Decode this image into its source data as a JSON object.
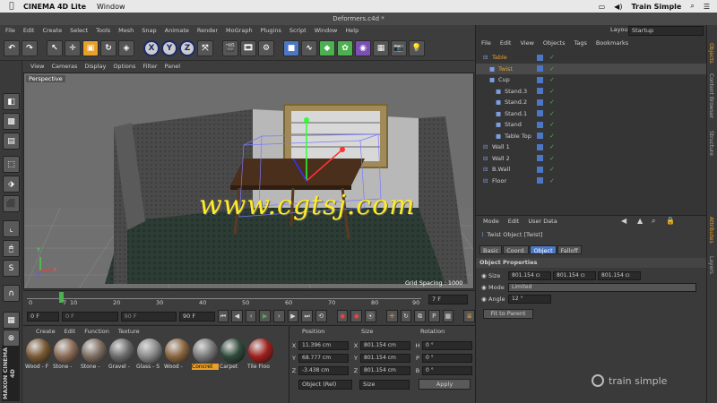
{
  "mac": {
    "app": "CINEMA 4D Lite",
    "menu": [
      "Window"
    ],
    "right_user": "Train Simple"
  },
  "window_title": "Deformers.c4d *",
  "menubar": [
    "File",
    "Edit",
    "Create",
    "Select",
    "Tools",
    "Mesh",
    "Snap",
    "Animate",
    "Render",
    "MoGraph",
    "Plugins",
    "Script",
    "Window",
    "Help"
  ],
  "toolbar": {
    "axes": [
      "X",
      "Y",
      "Z"
    ]
  },
  "viewport": {
    "menu": [
      "View",
      "Cameras",
      "Display",
      "Options",
      "Filter",
      "Panel"
    ],
    "label": "Perspective",
    "grid_spacing": "Grid Spacing : 1000 cm",
    "watermark": "www.cgtsj.com",
    "axis_x": "X",
    "axis_y": "Y",
    "axis_z": "Z"
  },
  "timeline": {
    "ticks": [
      "0",
      "10",
      "20",
      "30",
      "40",
      "50",
      "60",
      "70",
      "80",
      "90"
    ],
    "current": "7",
    "frame_readout": "7 F"
  },
  "transport": {
    "start": "0 F",
    "preview_start": "0 F",
    "preview_end": "90 F",
    "end": "90 F"
  },
  "materials": {
    "menu": [
      "Create",
      "Edit",
      "Function",
      "Texture"
    ],
    "items": [
      {
        "label": "Wood - F",
        "color": "#7a5a34"
      },
      {
        "label": "Stone - ",
        "color": "#8a6a55"
      },
      {
        "label": "Stone - ",
        "color": "#7d6d60"
      },
      {
        "label": "Gravel - ",
        "color": "#6b6b6b"
      },
      {
        "label": "Glass - S",
        "color": "#8a8a8a"
      },
      {
        "label": "Wood - ",
        "color": "#8a6540"
      },
      {
        "label": "Concret",
        "color": "#7a7a7a"
      },
      {
        "label": "Carpet",
        "color": "#2f4a3a"
      },
      {
        "label": "Tile Floo",
        "color": "#a0201e"
      }
    ]
  },
  "coords": {
    "headers": [
      "Position",
      "Size",
      "Rotation"
    ],
    "rows": [
      {
        "a": "X",
        "pos": "11.396 cm",
        "sa": "X",
        "size": "801.154 cm",
        "ra": "H",
        "rot": "0 °"
      },
      {
        "a": "Y",
        "pos": "68.777 cm",
        "sa": "Y",
        "size": "801.154 cm",
        "ra": "P",
        "rot": "0 °"
      },
      {
        "a": "Z",
        "pos": "-3.438 cm",
        "sa": "Z",
        "size": "801.154 cm",
        "ra": "B",
        "rot": "0 °"
      }
    ],
    "mode": "Object (Rel)",
    "size_mode": "Size",
    "apply": "Apply"
  },
  "layout": {
    "label": "Layout:",
    "value": "Startup"
  },
  "objects": {
    "menu": [
      "File",
      "Edit",
      "View",
      "Objects",
      "Tags",
      "Bookmarks"
    ],
    "items": [
      {
        "name": "Table",
        "indent": 0,
        "color": "#e8a02a"
      },
      {
        "name": "Twist",
        "indent": 1,
        "color": "#e8a02a"
      },
      {
        "name": "Cup",
        "indent": 1,
        "color": "#d0d0d0"
      },
      {
        "name": "Stand.3",
        "indent": 2,
        "color": "#d0d0d0"
      },
      {
        "name": "Stand.2",
        "indent": 2,
        "color": "#d0d0d0"
      },
      {
        "name": "Stand.1",
        "indent": 2,
        "color": "#d0d0d0"
      },
      {
        "name": "Stand",
        "indent": 2,
        "color": "#d0d0d0"
      },
      {
        "name": "Table Top",
        "indent": 2,
        "color": "#d0d0d0"
      },
      {
        "name": "Wall 1",
        "indent": 0,
        "color": "#d0d0d0"
      },
      {
        "name": "Wall 2",
        "indent": 0,
        "color": "#d0d0d0"
      },
      {
        "name": "B.Wall",
        "indent": 0,
        "color": "#d0d0d0"
      },
      {
        "name": "Floor",
        "indent": 0,
        "color": "#d0d0d0"
      }
    ]
  },
  "attributes": {
    "menu": [
      "Mode",
      "Edit",
      "User Data"
    ],
    "object": "Twist Object [Twist]",
    "tabs": [
      "Basic",
      "Coord.",
      "Object",
      "Falloff"
    ],
    "active_tab": "Object",
    "section": "Object Properties",
    "size_label": "Size",
    "size": [
      "801.154 cı",
      "801.154 cı",
      "801.154 cı"
    ],
    "mode_label": "Mode",
    "mode": "Limited",
    "angle_label": "Angle",
    "angle": "12 °",
    "fit": "Fit to Parent"
  },
  "side_tabs": [
    "Objects",
    "Content Browser",
    "Structure",
    "Attributes",
    "Layers"
  ],
  "brand": "train simple",
  "maxon": "MAXON CINEMA 4D"
}
